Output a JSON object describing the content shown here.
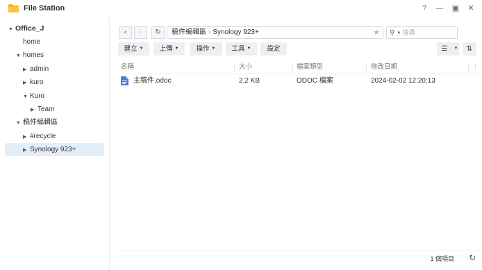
{
  "app": {
    "title": "File Station",
    "window_controls": {
      "help": "?",
      "minimize": "—",
      "maximize": "▣",
      "close": "✕"
    }
  },
  "sidebar": {
    "items": [
      {
        "label": "Office_J",
        "expanded": true
      },
      {
        "label": "home"
      },
      {
        "label": "homes",
        "expanded": true
      },
      {
        "label": "admin"
      },
      {
        "label": "kuro"
      },
      {
        "label": "Kuro",
        "expanded": true
      },
      {
        "label": "Team"
      },
      {
        "label": "稿件編輯區",
        "expanded": true
      },
      {
        "label": "#recycle"
      },
      {
        "label": "Synology 923+",
        "selected": true
      }
    ]
  },
  "navigation": {
    "back_icon": "chevron-left-icon",
    "forward_icon": "chevron-right-icon",
    "refresh_icon": "refresh-icon",
    "path": [
      "稿件編輯區",
      "Synology 923+"
    ],
    "search_placeholder": "搜尋"
  },
  "toolbar": {
    "create_label": "建立",
    "upload_label": "上傳",
    "action_label": "操作",
    "tools_label": "工具",
    "settings_label": "設定"
  },
  "table": {
    "columns": [
      "名稱",
      "大小",
      "檔案類型",
      "修改日期"
    ],
    "rows": [
      {
        "name": "主稿件.odoc",
        "size": "2.2 KB",
        "type": "ODOC 檔案",
        "modified": "2024-02-02 12:20:13"
      }
    ]
  },
  "footer": {
    "count_label": "1 個項目"
  },
  "colors": {
    "accent": "#2d7dd2",
    "selected_bg": "#e3eef9",
    "folder": "#f5b32a"
  }
}
